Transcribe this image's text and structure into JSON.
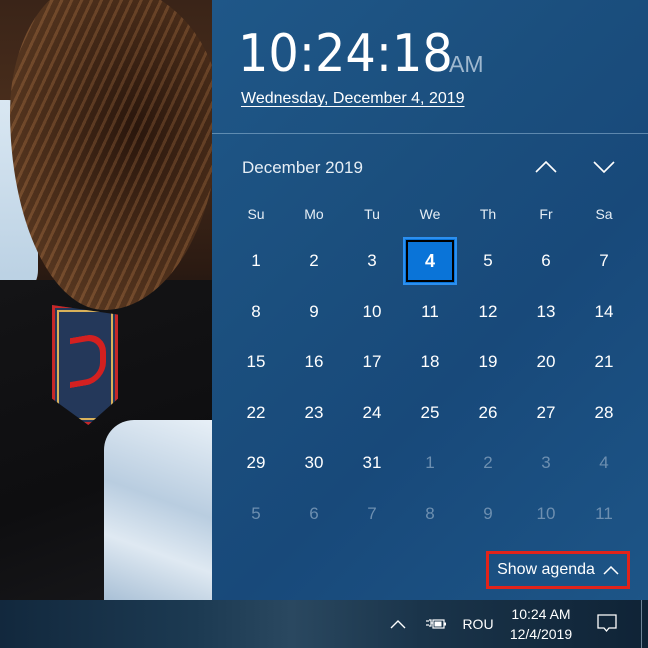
{
  "clock": {
    "time": "10:24:18",
    "ampm": "AM",
    "date": "Wednesday, December 4, 2019"
  },
  "calendar": {
    "month_label": "December 2019",
    "nav": {
      "prev_icon": "chevron-up-icon",
      "next_icon": "chevron-down-icon"
    },
    "weekdays": [
      "Su",
      "Mo",
      "Tu",
      "We",
      "Th",
      "Fr",
      "Sa"
    ],
    "today": "4",
    "days": [
      {
        "d": "1",
        "current": true
      },
      {
        "d": "2",
        "current": true
      },
      {
        "d": "3",
        "current": true
      },
      {
        "d": "4",
        "current": true,
        "today": true
      },
      {
        "d": "5",
        "current": true
      },
      {
        "d": "6",
        "current": true
      },
      {
        "d": "7",
        "current": true
      },
      {
        "d": "8",
        "current": true
      },
      {
        "d": "9",
        "current": true
      },
      {
        "d": "10",
        "current": true
      },
      {
        "d": "11",
        "current": true
      },
      {
        "d": "12",
        "current": true
      },
      {
        "d": "13",
        "current": true
      },
      {
        "d": "14",
        "current": true
      },
      {
        "d": "15",
        "current": true
      },
      {
        "d": "16",
        "current": true
      },
      {
        "d": "17",
        "current": true
      },
      {
        "d": "18",
        "current": true
      },
      {
        "d": "19",
        "current": true
      },
      {
        "d": "20",
        "current": true
      },
      {
        "d": "21",
        "current": true
      },
      {
        "d": "22",
        "current": true
      },
      {
        "d": "23",
        "current": true
      },
      {
        "d": "24",
        "current": true
      },
      {
        "d": "25",
        "current": true
      },
      {
        "d": "26",
        "current": true
      },
      {
        "d": "27",
        "current": true
      },
      {
        "d": "28",
        "current": true
      },
      {
        "d": "29",
        "current": true
      },
      {
        "d": "30",
        "current": true
      },
      {
        "d": "31",
        "current": true
      },
      {
        "d": "1",
        "current": false
      },
      {
        "d": "2",
        "current": false
      },
      {
        "d": "3",
        "current": false
      },
      {
        "d": "4",
        "current": false
      },
      {
        "d": "5",
        "current": false
      },
      {
        "d": "6",
        "current": false
      },
      {
        "d": "7",
        "current": false
      },
      {
        "d": "8",
        "current": false
      },
      {
        "d": "9",
        "current": false
      },
      {
        "d": "10",
        "current": false
      },
      {
        "d": "11",
        "current": false
      }
    ]
  },
  "agenda": {
    "label": "Show agenda",
    "icon": "chevron-up-icon",
    "highlight_color": "#e2231a"
  },
  "taskbar": {
    "hidden_icons": "chevron-up-icon",
    "power_icon": "power-plug-battery-icon",
    "language": "ROU",
    "time": "10:24 AM",
    "date": "12/4/2019",
    "action_center_icon": "action-center-icon"
  },
  "colors": {
    "panel": "#1b4f7e",
    "today_accent": "#0a74d8",
    "taskbar": "#12283d"
  }
}
